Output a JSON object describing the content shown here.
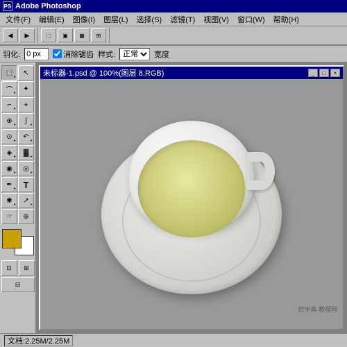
{
  "app": {
    "title": "Adobe Photoshop",
    "title_icon": "PS"
  },
  "menu": {
    "items": [
      {
        "label": "文件(F)"
      },
      {
        "label": "编辑(E)"
      },
      {
        "label": "图像(I)"
      },
      {
        "label": "图层(L)"
      },
      {
        "label": "选择(S)"
      },
      {
        "label": "滤镜(T)"
      },
      {
        "label": "视图(V)"
      },
      {
        "label": "窗口(W)"
      },
      {
        "label": "帮助(H)"
      }
    ]
  },
  "toolbar": {
    "buttons": [
      "□",
      "□",
      "□",
      "□",
      "□",
      "□"
    ]
  },
  "options_bar": {
    "feather_label": "羽化:",
    "feather_value": "0 px",
    "antialias_label": "消除锯齿",
    "style_label": "样式:",
    "style_value": "正常",
    "width_label": "宽度"
  },
  "document": {
    "title": "未标器-1.psd @ 100%(图层 8,RGB)",
    "controls": [
      "_",
      "□",
      "×"
    ]
  },
  "status_bar": {
    "doc_info": "文档:2.25M/2.25M"
  },
  "tools": [
    {
      "icon": "⬚",
      "name": "marquee-tool"
    },
    {
      "icon": "↖",
      "name": "move-tool"
    },
    {
      "icon": "⊙",
      "name": "lasso-tool"
    },
    {
      "icon": "✦",
      "name": "magic-wand-tool"
    },
    {
      "icon": "✂",
      "name": "crop-tool"
    },
    {
      "icon": "⌖",
      "name": "slice-tool"
    },
    {
      "icon": "✎",
      "name": "heal-tool"
    },
    {
      "icon": "🖌",
      "name": "brush-tool"
    },
    {
      "icon": "S",
      "name": "stamp-tool"
    },
    {
      "icon": "↶",
      "name": "history-tool"
    },
    {
      "icon": "◈",
      "name": "eraser-tool"
    },
    {
      "icon": "▓",
      "name": "fill-tool"
    },
    {
      "icon": "◉",
      "name": "blur-tool"
    },
    {
      "icon": "◎",
      "name": "dodge-tool"
    },
    {
      "icon": "✒",
      "name": "pen-tool"
    },
    {
      "icon": "T",
      "name": "text-tool"
    },
    {
      "icon": "✱",
      "name": "custom-shape-tool"
    },
    {
      "icon": "↗",
      "name": "path-select-tool"
    },
    {
      "icon": "☞",
      "name": "hand-tool"
    },
    {
      "icon": "⊕",
      "name": "zoom-tool"
    }
  ],
  "colors": {
    "foreground": "#c8a000",
    "background": "#ffffff",
    "accent_blue": "#000080",
    "ui_gray": "#c0c0c0",
    "dark_gray": "#808080",
    "tea_color": "#d0d080"
  },
  "watermark": {
    "text": "世宇典 教程网"
  }
}
